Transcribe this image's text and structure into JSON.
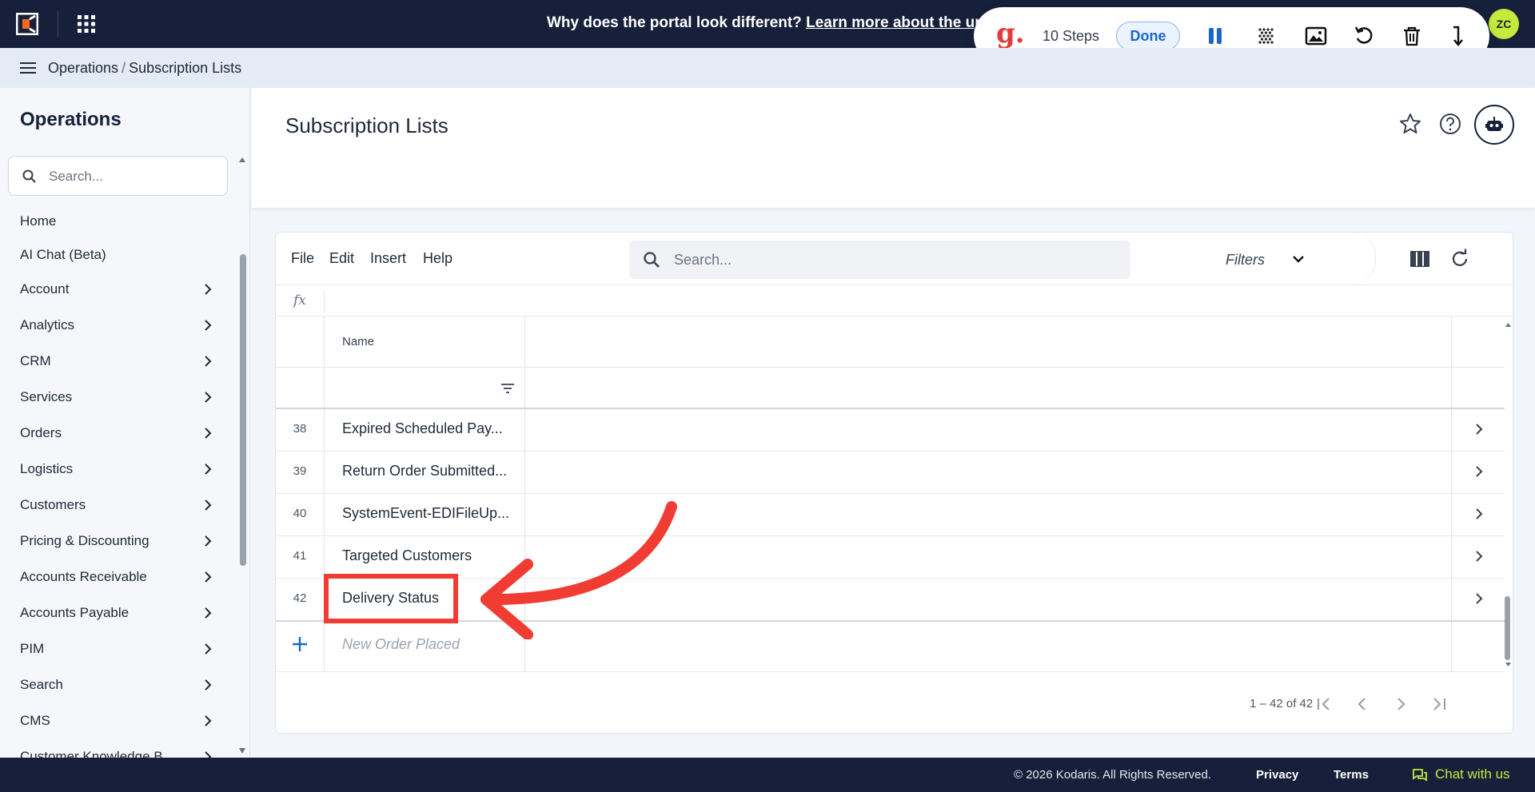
{
  "topbar": {
    "banner_text": "Why does the portal look different?",
    "banner_link": "Learn more about the update",
    "avatar_initials": "ZC"
  },
  "recorder": {
    "steps_label": "10 Steps",
    "done_label": "Done"
  },
  "breadcrumb": {
    "items": [
      "Operations",
      "Subscription Lists"
    ],
    "separator": "/"
  },
  "sidebar": {
    "title": "Operations",
    "search_placeholder": "Search...",
    "items": [
      {
        "label": "Home",
        "chevron": false
      },
      {
        "label": "AI Chat (Beta)",
        "chevron": false
      },
      {
        "label": "Account",
        "chevron": true
      },
      {
        "label": "Analytics",
        "chevron": true
      },
      {
        "label": "CRM",
        "chevron": true
      },
      {
        "label": "Services",
        "chevron": true
      },
      {
        "label": "Orders",
        "chevron": true
      },
      {
        "label": "Logistics",
        "chevron": true
      },
      {
        "label": "Customers",
        "chevron": true
      },
      {
        "label": "Pricing & Discounting",
        "chevron": true
      },
      {
        "label": "Accounts Receivable",
        "chevron": true
      },
      {
        "label": "Accounts Payable",
        "chevron": true
      },
      {
        "label": "PIM",
        "chevron": true
      },
      {
        "label": "Search",
        "chevron": true
      },
      {
        "label": "CMS",
        "chevron": true
      },
      {
        "label": "Customer Knowledge B...",
        "chevron": true
      }
    ]
  },
  "page": {
    "title": "Subscription Lists"
  },
  "grid": {
    "menu": [
      "File",
      "Edit",
      "Insert",
      "Help"
    ],
    "search_placeholder": "Search...",
    "filters_label": "Filters",
    "fx_label": "fx",
    "column_header": "Name",
    "rows": [
      {
        "num": "38",
        "name": "Expired Scheduled Pay..."
      },
      {
        "num": "39",
        "name": "Return Order Submitted..."
      },
      {
        "num": "40",
        "name": "SystemEvent-EDIFileUp..."
      },
      {
        "num": "41",
        "name": "Targeted Customers"
      },
      {
        "num": "42",
        "name": "Delivery Status"
      }
    ],
    "new_row_placeholder": "New Order Placed",
    "pager_text": "1 – 42 of 42"
  },
  "footer": {
    "copyright": "© 2026 Kodaris. All Rights Reserved.",
    "privacy": "Privacy",
    "terms": "Terms",
    "chat": "Chat with us"
  },
  "colors": {
    "navy": "#16203a",
    "accent_lime": "#c5ea3c",
    "annotation_red": "#f03c32",
    "done_blue": "#1a66c9"
  }
}
